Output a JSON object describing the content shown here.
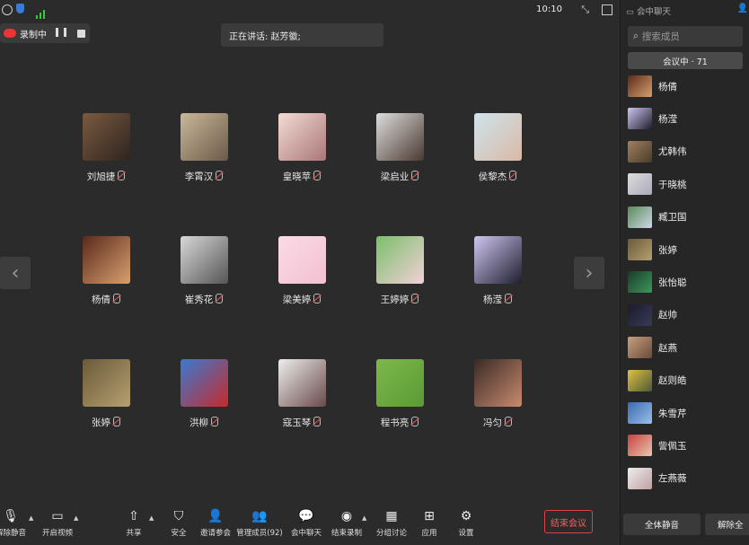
{
  "status": {
    "time": "10:10"
  },
  "recording": {
    "label": "录制中"
  },
  "speaking": {
    "text": "正在讲话: 赵芳徽;"
  },
  "participants": [
    {
      "name": "刘旭捷",
      "c1": "#7a5a40",
      "c2": "#2e2420"
    },
    {
      "name": "李霄汉",
      "c1": "#c9b89a",
      "c2": "#6b5a48"
    },
    {
      "name": "皇晓苹",
      "c1": "#f4dcd4",
      "c2": "#a77"
    },
    {
      "name": "梁启业",
      "c1": "#ddd",
      "c2": "#4a3a30"
    },
    {
      "name": "侯黎杰",
      "c1": "#cfe3ec",
      "c2": "#d9b9a6"
    },
    {
      "name": "杨倩",
      "c1": "#5a2a1a",
      "c2": "#d8a070"
    },
    {
      "name": "崔秀花",
      "c1": "#d8d8d8",
      "c2": "#555"
    },
    {
      "name": "梁美婷",
      "c1": "#fadbe6",
      "c2": "#f3c0d0"
    },
    {
      "name": "王婷婷",
      "c1": "#7bbf6a",
      "c2": "#f2d0d8"
    },
    {
      "name": "杨滢",
      "c1": "#cfc6f0",
      "c2": "#1e1e2e"
    },
    {
      "name": "张婷",
      "c1": "#6a5a3a",
      "c2": "#b6a070"
    },
    {
      "name": "洪柳",
      "c1": "#3a7ad0",
      "c2": "#c62a2a"
    },
    {
      "name": "寇玉琴",
      "c1": "#eee",
      "c2": "#6a4a4a"
    },
    {
      "name": "程书亮",
      "c1": "#7db84a",
      "c2": "#5a9a36"
    },
    {
      "name": "冯匀",
      "c1": "#3a2a24",
      "c2": "#c98a70"
    }
  ],
  "toolbar": {
    "unmute": "解除静音",
    "video": "开启视频",
    "share": "共享",
    "security": "安全",
    "invite": "邀请参会",
    "manage": "管理成员(92)",
    "chat": "会中聊天",
    "stop_record": "结束录制",
    "breakout": "分组讨论",
    "apps": "应用",
    "settings": "设置",
    "end": "结束会议"
  },
  "sidebar": {
    "title": "会中聊天",
    "search_placeholder": "搜索成员",
    "tab": "会议中 · 71",
    "members": [
      {
        "name": "杨倩",
        "c1": "#5a2a1a",
        "c2": "#d8a070"
      },
      {
        "name": "杨滢",
        "c1": "#cfc6f0",
        "c2": "#1e1e2e"
      },
      {
        "name": "尤韩伟",
        "c1": "#a08060",
        "c2": "#4a3a2a"
      },
      {
        "name": "于晓桃",
        "c1": "#ddd",
        "c2": "#aab"
      },
      {
        "name": "臧卫国",
        "c1": "#5a8a5a",
        "c2": "#cfd8e8"
      },
      {
        "name": "张婷",
        "c1": "#6a5a3a",
        "c2": "#b6a070"
      },
      {
        "name": "张怡聪",
        "c1": "#1a3a2a",
        "c2": "#3a9a5a"
      },
      {
        "name": "赵帅",
        "c1": "#1a1a2a",
        "c2": "#3a3a5a"
      },
      {
        "name": "赵燕",
        "c1": "#c8a080",
        "c2": "#6a4a3a"
      },
      {
        "name": "赵则皓",
        "c1": "#e0c040",
        "c2": "#4a5a3a"
      },
      {
        "name": "朱雪芹",
        "c1": "#3a6ab0",
        "c2": "#9ac0e8"
      },
      {
        "name": "訾佩玉",
        "c1": "#c84040",
        "c2": "#e8c8b0"
      },
      {
        "name": "左燕薇",
        "c1": "#eee",
        "c2": "#c0a0a0"
      }
    ],
    "mute_all": "全体静音",
    "unmute_all": "解除全"
  }
}
